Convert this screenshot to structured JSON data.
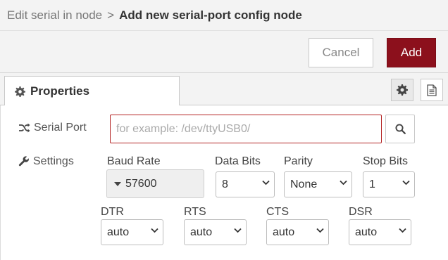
{
  "breadcrumb": {
    "parent": "Edit serial in node",
    "separator": ">",
    "current": "Add new serial-port config node"
  },
  "actions": {
    "cancel_label": "Cancel",
    "add_label": "Add"
  },
  "tabs": {
    "properties_label": "Properties"
  },
  "serial_port": {
    "label": "Serial Port",
    "placeholder": "for example: /dev/ttyUSB0/",
    "value": ""
  },
  "settings": {
    "label": "Settings",
    "baud_rate": {
      "label": "Baud Rate",
      "value": "57600"
    },
    "data_bits": {
      "label": "Data Bits",
      "value": "8"
    },
    "parity": {
      "label": "Parity",
      "value": "None"
    },
    "stop_bits": {
      "label": "Stop Bits",
      "value": "1"
    },
    "dtr": {
      "label": "DTR",
      "value": "auto"
    },
    "rts": {
      "label": "RTS",
      "value": "auto"
    },
    "cts": {
      "label": "CTS",
      "value": "auto"
    },
    "dsr": {
      "label": "DSR",
      "value": "auto"
    }
  },
  "colors": {
    "add_button": "#8c101c",
    "input_error_border": "#b42323"
  },
  "icons": {
    "properties": "gear-icon",
    "serial_port": "shuffle-icon",
    "settings": "wrench-icon",
    "search": "search-icon",
    "description": "document-icon"
  }
}
